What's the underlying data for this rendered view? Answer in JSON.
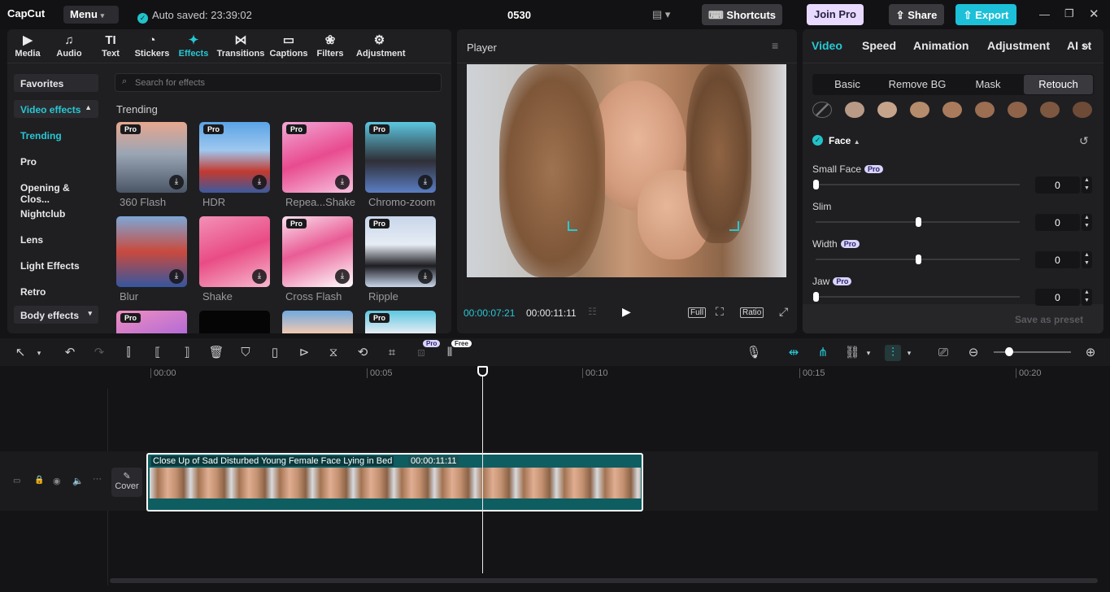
{
  "app": {
    "logo": "CapCut",
    "menu_label": "Menu",
    "autosave": "Auto saved: 23:39:02",
    "project_title": "0530",
    "shortcuts_label": "Shortcuts",
    "joinpro_label": "Join Pro",
    "share_label": "Share",
    "export_label": "Export"
  },
  "colors": {
    "accent": "#27c8d4",
    "bg": "#141416",
    "panel": "#1f1f22",
    "export": "#1cc0d8",
    "joinpro": "#e8d9ff",
    "clip": "#0e5d61"
  },
  "toolbar": [
    {
      "label": "Media",
      "icon": "media-icon",
      "glyph": "▶"
    },
    {
      "label": "Audio",
      "icon": "audio-icon",
      "glyph": "♫"
    },
    {
      "label": "Text",
      "icon": "text-icon",
      "glyph": "TI"
    },
    {
      "label": "Stickers",
      "icon": "stickers-icon",
      "glyph": "◔"
    },
    {
      "label": "Effects",
      "icon": "effects-icon",
      "glyph": "✦"
    },
    {
      "label": "Transitions",
      "icon": "transitions-icon",
      "glyph": "⋈"
    },
    {
      "label": "Captions",
      "icon": "captions-icon",
      "glyph": "▭"
    },
    {
      "label": "Filters",
      "icon": "filters-icon",
      "glyph": "❀"
    },
    {
      "label": "Adjustment",
      "icon": "adjustment-icon",
      "glyph": "⚙"
    }
  ],
  "sidebar": {
    "favorites": "Favorites",
    "video_effects": "Video effects",
    "items": [
      "Trending",
      "Pro",
      "Opening & Clos...",
      "Nightclub",
      "Lens",
      "Light Effects",
      "Retro"
    ],
    "body_effects": "Body effects"
  },
  "effects": {
    "search_placeholder": "Search for effects",
    "section": "Trending",
    "badge": "Pro",
    "items": [
      "360 Flash",
      "HDR",
      "Repea...Shake",
      "Chromo-zoom",
      "Blur",
      "Shake",
      "Cross Flash",
      "Ripple"
    ]
  },
  "player": {
    "title": "Player",
    "current_time": "00:00:07:21",
    "duration": "00:00:11:11",
    "full_label": "Full",
    "ratio_label": "Ratio"
  },
  "right_panel": {
    "tabs": [
      "Video",
      "Speed",
      "Animation",
      "Adjustment",
      "AI styli"
    ],
    "segments": [
      "Basic",
      "Remove BG",
      "Mask",
      "Retouch"
    ],
    "face_label": "Face",
    "pro_badge": "Pro",
    "sliders": [
      {
        "label": "Small Face",
        "pro": true,
        "value": "0",
        "level": 0
      },
      {
        "label": "Slim",
        "pro": false,
        "value": "0",
        "level": 0.5
      },
      {
        "label": "Width",
        "pro": true,
        "value": "0",
        "level": 0.5
      },
      {
        "label": "Jaw",
        "pro": true,
        "value": "0",
        "level": 0
      }
    ],
    "save_preset": "Save as preset",
    "swatches": [
      "#b89a86",
      "#c6a48b",
      "#b58c6c",
      "#a97b5c",
      "#9c6e52",
      "#8e6349",
      "#7d573f",
      "#6e4b36"
    ]
  },
  "timeline": {
    "ruler": [
      "00:00",
      "00:05",
      "00:10",
      "00:15",
      "00:20"
    ],
    "clip_title": "Close Up of Sad Disturbed Young Female Face Lying in Bed",
    "clip_duration": "00:00:11:11",
    "cover_label": "Cover",
    "pro_tag": "Pro",
    "free_tag": "Free"
  }
}
